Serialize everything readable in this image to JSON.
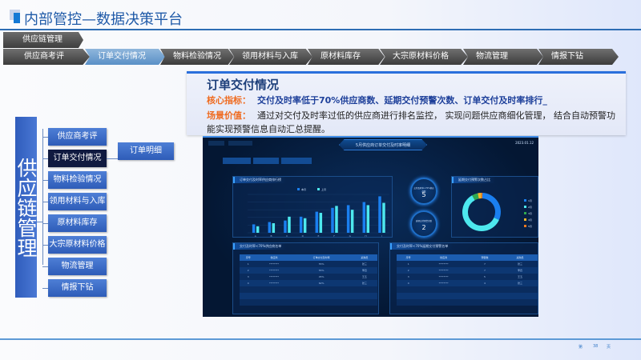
{
  "header": {
    "title": "内部管控—数据决策平台"
  },
  "breadcrumb": {
    "root": "供应链管理"
  },
  "steps": [
    "供应商考评",
    "订单交付情况",
    "物料检验情况",
    "领用材料与入库",
    "原材料库存",
    "大宗原材料价格",
    "物流管理",
    "情报下钻"
  ],
  "active_step": 1,
  "card": {
    "title": "订单交付情况",
    "kpi_label": "核心指标：",
    "kpi_text": "交付及时率低于70%供应商数、延期交付预警次数、订单交付及时率排行_",
    "value_label": "场景价值：",
    "value_text": "通过对交付及时率过低的供应商进行排名监控， 实现问题供应商细化管理， 结合自动预警功能实现预警信息自动汇总提醒。"
  },
  "tree": {
    "root": "供应链管理",
    "children": [
      "供应商考评",
      "订单交付情况",
      "物料检验情况",
      "领用材料与入库",
      "原材料库存",
      "大宗原材料价格",
      "物流管理",
      "情报下钻"
    ],
    "sub": "订单明细"
  },
  "dashboard": {
    "title": "5月供应商订单交付及时率明细",
    "date": "2023.01.12",
    "bar_title": "订单交付及时率供应商排行榜",
    "kpi1": {
      "label": "交付及时率<70%供应商数",
      "value": "5"
    },
    "kpi2": {
      "label": "延期交付预警次数",
      "value": "2"
    },
    "donut_title": "延期交付预警次数占比",
    "table1": {
      "title": "交付及时率<70%供应商名单",
      "headers": [
        "序号",
        "供应商",
        "订单交付及时率",
        "采购员"
      ],
      "rows": [
        [
          "1",
          "********",
          "55%",
          "张三"
        ],
        [
          "2",
          "********",
          "55%",
          "李四"
        ],
        [
          "3",
          "********",
          "45%",
          "王五"
        ],
        [
          "4",
          "********",
          "62%",
          "张三"
        ]
      ]
    },
    "table2": {
      "title": "交付及时率<70%延期交付预警名单",
      "headers": [
        "序号",
        "供应商",
        "预警数",
        "采购员"
      ],
      "rows": [
        [
          "1",
          "********",
          "7",
          "张三"
        ],
        [
          "2",
          "********",
          "7",
          "李四"
        ],
        [
          "3",
          "********",
          "5",
          "王五"
        ],
        [
          "4",
          "********",
          "4",
          "张三"
        ]
      ]
    }
  },
  "chart_data": [
    {
      "type": "bar",
      "title": "订单交付及时率供应商排行榜",
      "categories": [
        "A",
        "B",
        "C",
        "D",
        "E",
        "F",
        "G",
        "H",
        "I"
      ],
      "ylim": [
        0,
        1
      ],
      "series": [
        {
          "name": "本月",
          "color": "#1a7ff0",
          "values": [
            0.22,
            0.28,
            0.32,
            0.42,
            0.55,
            0.65,
            0.72,
            0.8,
            0.95
          ]
        },
        {
          "name": "上月",
          "color": "#4de8ee",
          "values": [
            0.17,
            0.25,
            0.42,
            0.38,
            0.52,
            0.7,
            0.6,
            0.72,
            0.78
          ]
        }
      ]
    },
    {
      "type": "pie",
      "title": "延期交付预警次数占比",
      "labels": [
        "1月",
        "2月",
        "3月",
        "4月",
        "5月"
      ],
      "values": [
        31,
        60,
        5,
        3,
        1
      ],
      "colors": [
        "#1a7ff0",
        "#4de8ee",
        "#2fa84f",
        "#f5b62b",
        "#f07a1e"
      ]
    }
  ],
  "footer": {
    "page_prefix": "第",
    "page": "38",
    "page_suffix": "页"
  }
}
